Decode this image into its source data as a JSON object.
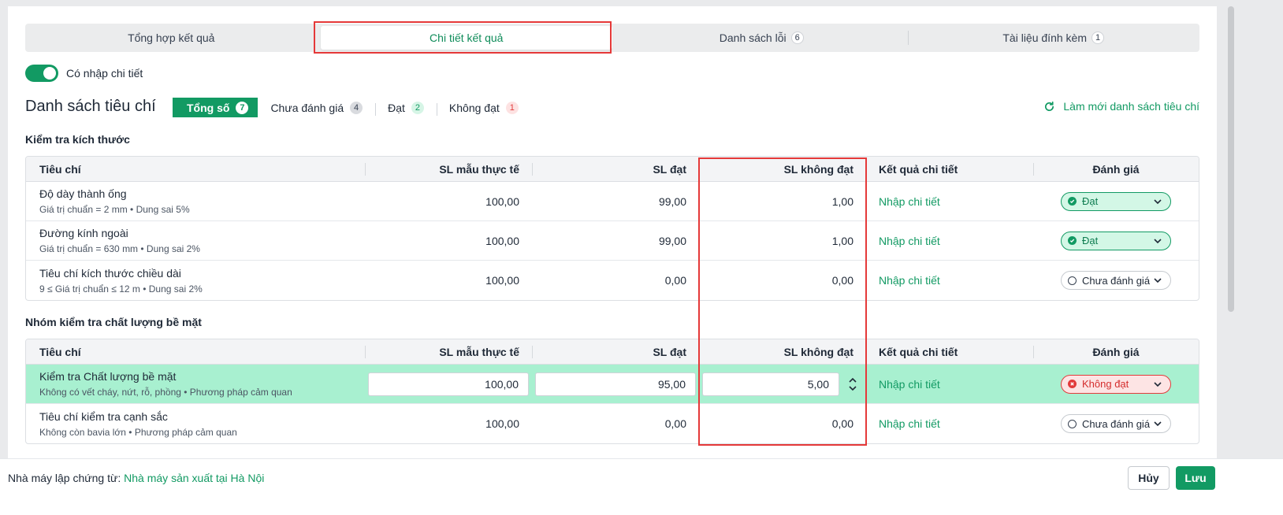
{
  "tabs": [
    {
      "label": "Tổng hợp kết quả",
      "count": ""
    },
    {
      "label": "Chi tiết kết quả",
      "count": ""
    },
    {
      "label": "Danh sách lỗi",
      "count": "6"
    },
    {
      "label": "Tài liệu đính kèm",
      "count": "1"
    }
  ],
  "toggle": {
    "label": "Có nhập chi tiết",
    "on": true
  },
  "criteria": {
    "title": "Danh sách tiêu chí",
    "filters": [
      {
        "label": "Tổng số",
        "count": "7"
      },
      {
        "label": "Chưa đánh giá",
        "count": "4"
      },
      {
        "label": "Đạt",
        "count": "2"
      },
      {
        "label": "Không đạt",
        "count": "1"
      }
    ],
    "refresh_label": "Làm mới danh sách tiêu chí"
  },
  "columns": [
    "Tiêu chí",
    "SL mẫu thực tế",
    "SL đạt",
    "SL không đạt",
    "Kết quả chi tiết",
    "Đánh giá"
  ],
  "groups": [
    {
      "title": "Kiểm tra kích thước",
      "rows": [
        {
          "name": "Độ dày thành ống",
          "sub": "Giá trị chuẩn = 2 mm • Dung sai 5%",
          "sample": "100,00",
          "pass": "99,00",
          "fail": "1,00",
          "detail": "Nhập chi tiết",
          "status": "Đạt",
          "status_type": "pass"
        },
        {
          "name": "Đường kính ngoài",
          "sub": "Giá trị chuẩn = 630 mm • Dung sai 2%",
          "sample": "100,00",
          "pass": "99,00",
          "fail": "1,00",
          "detail": "Nhập chi tiết",
          "status": "Đạt",
          "status_type": "pass"
        },
        {
          "name": "Tiêu chí kích thước chiều dài",
          "sub": "9 ≤ Giá trị chuẩn ≤ 12 m • Dung sai 2%",
          "sample": "100,00",
          "pass": "0,00",
          "fail": "0,00",
          "detail": "Nhập chi tiết",
          "status": "Chưa đánh giá",
          "status_type": "none"
        }
      ]
    },
    {
      "title": "Nhóm kiểm tra chất lượng bề mặt",
      "rows": [
        {
          "name": "Kiểm tra Chất lượng bề mặt",
          "sub": "Không có vết cháy, nứt, rỗ, phồng • Phương pháp cảm quan",
          "sample": "100,00",
          "pass": "95,00",
          "fail": "5,00",
          "detail": "Nhập chi tiết",
          "status": "Không đạt",
          "status_type": "fail",
          "editing": true
        },
        {
          "name": "Tiêu chí kiểm tra cạnh sắc",
          "sub": "Không còn bavia lớn • Phương pháp cảm quan",
          "sample": "100,00",
          "pass": "0,00",
          "fail": "0,00",
          "detail": "Nhập chi tiết",
          "status": "Chưa đánh giá",
          "status_type": "none"
        }
      ]
    }
  ],
  "footer": {
    "label": "Nhà máy lập chứng từ:",
    "value": "Nhà máy sản xuất tại Hà Nội",
    "cancel": "Hủy",
    "save": "Lưu"
  },
  "colors": {
    "accent": "#129a63",
    "highlight": "#e53939",
    "selected_row": "#a8f0d0",
    "fail": "#e23b3b"
  }
}
